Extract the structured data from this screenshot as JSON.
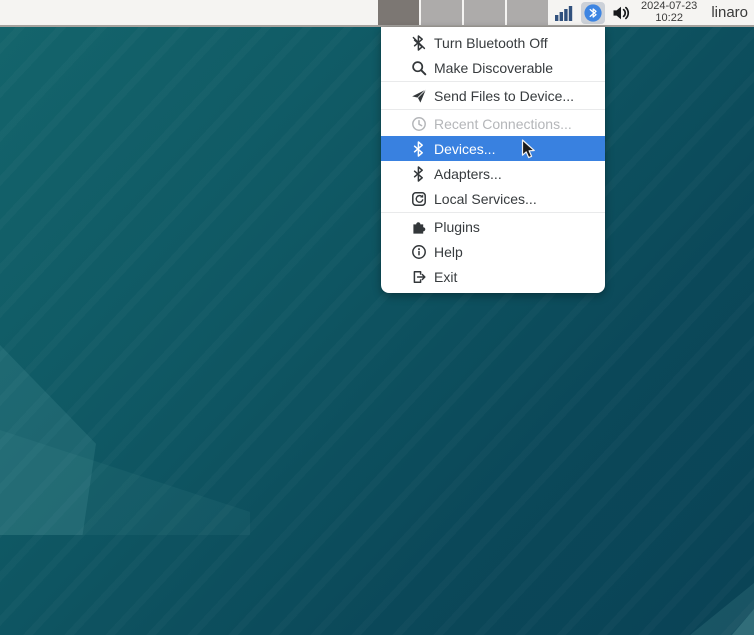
{
  "panel": {
    "pager": {
      "workspace_count": 4,
      "active_index": 0
    },
    "tray_icons": [
      "network-signal-icon",
      "bluetooth-tray-icon",
      "volume-icon"
    ],
    "clock": {
      "date": "2024-07-23",
      "time": "10:22"
    },
    "user": "linaro"
  },
  "menu": {
    "items": [
      {
        "label": "Turn Bluetooth Off",
        "icon": "bluetooth-disabled-icon",
        "state": "normal"
      },
      {
        "label": "Make Discoverable",
        "icon": "search-icon",
        "state": "normal"
      },
      {
        "type": "separator"
      },
      {
        "label": "Send Files to Device...",
        "icon": "send-icon",
        "state": "normal"
      },
      {
        "type": "separator"
      },
      {
        "label": "Recent Connections...",
        "icon": "clock-icon",
        "state": "disabled"
      },
      {
        "label": "Devices...",
        "icon": "bluetooth-icon",
        "state": "highlighted"
      },
      {
        "label": "Adapters...",
        "icon": "bluetooth-icon",
        "state": "normal"
      },
      {
        "label": "Local Services...",
        "icon": "services-icon",
        "state": "normal"
      },
      {
        "type": "separator"
      },
      {
        "label": "Plugins",
        "icon": "plugins-icon",
        "state": "normal"
      },
      {
        "label": "Help",
        "icon": "help-icon",
        "state": "normal"
      },
      {
        "label": "Exit",
        "icon": "exit-icon",
        "state": "normal"
      }
    ]
  },
  "colors": {
    "highlight_blue": "#3981e0",
    "menu_bg": "#ffffff",
    "menu_text": "#373b3e",
    "disabled_text": "#b4b6b9",
    "panel_bg": "#f5f4f2",
    "pager_active": "#7c7773",
    "pager_inactive": "#adabaa",
    "desktop_teal_light": "#14656c",
    "desktop_teal_dark": "#0a4356",
    "bluetooth_blue": "#3d85e2"
  }
}
